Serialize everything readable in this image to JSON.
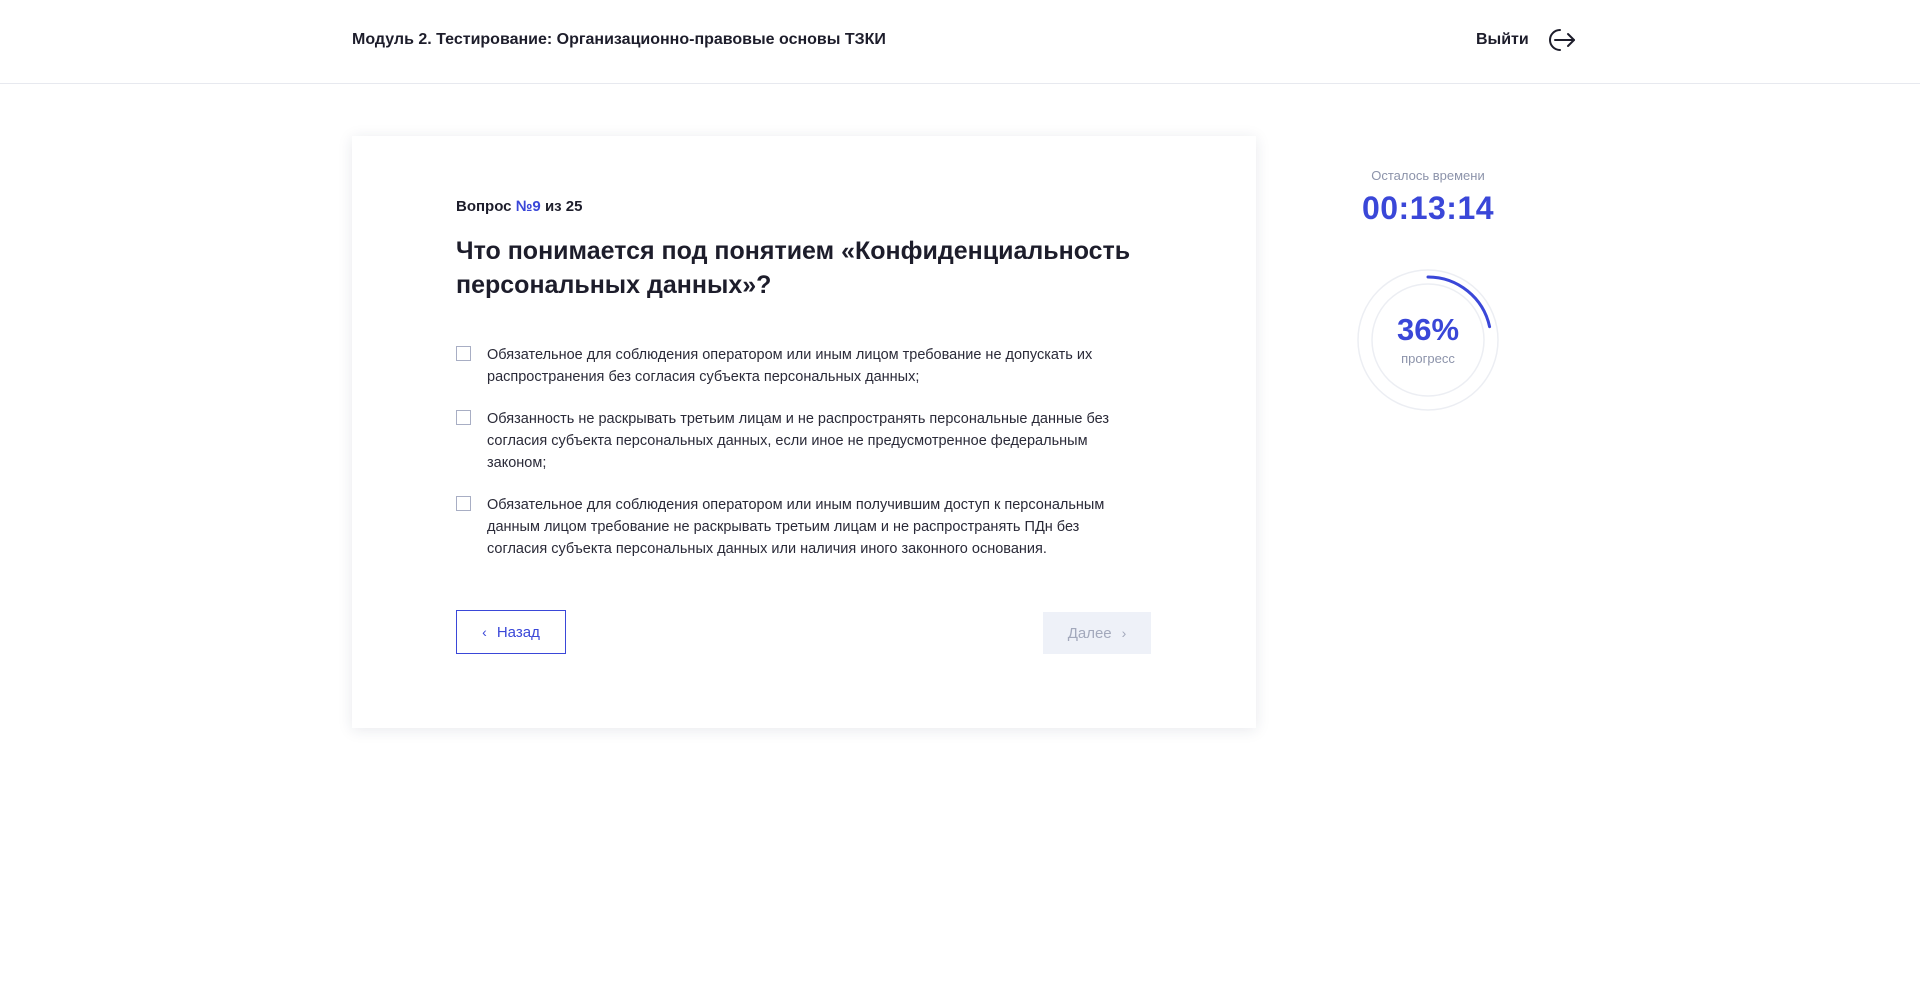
{
  "header": {
    "title": "Модуль 2. Тестирование: Организационно-правовые основы ТЗКИ",
    "logout_label": "Выйти"
  },
  "question": {
    "prefix": "Вопрос",
    "number": "№9",
    "suffix": "из 25",
    "text": "Что понимается под понятием «Конфиденциальность персональных данных»?",
    "answers": [
      "Обязательное для соблюдения оператором или иным лицом требование не допускать их распространения без согласия субъекта персональных данных;",
      "Обязанность не раскрывать третьим лицам и не распространять персональные данные без согласия субъекта персональных данных, если иное не предусмотренное федеральным законом;",
      "Обязательное для соблюдения оператором или иным получившим доступ к персональным данным лицом требование не раскрывать третьим лицам и  не распространять ПДн без согласия субъекта персональных данных или наличия иного законного основания."
    ]
  },
  "nav": {
    "back_label": "Назад",
    "next_label": "Далее"
  },
  "timer": {
    "label": "Осталось времени",
    "value": "00:13:14"
  },
  "progress": {
    "value_text": "36%",
    "fraction": 0.36,
    "label": "прогресс"
  },
  "icons": {
    "logout": "logout-arrow-icon",
    "back": "chevron-left-icon",
    "next": "chevron-right-icon"
  },
  "colors": {
    "accent": "#3a47d8",
    "muted": "#8c93aa",
    "disabled_bg": "#eef1f8"
  }
}
